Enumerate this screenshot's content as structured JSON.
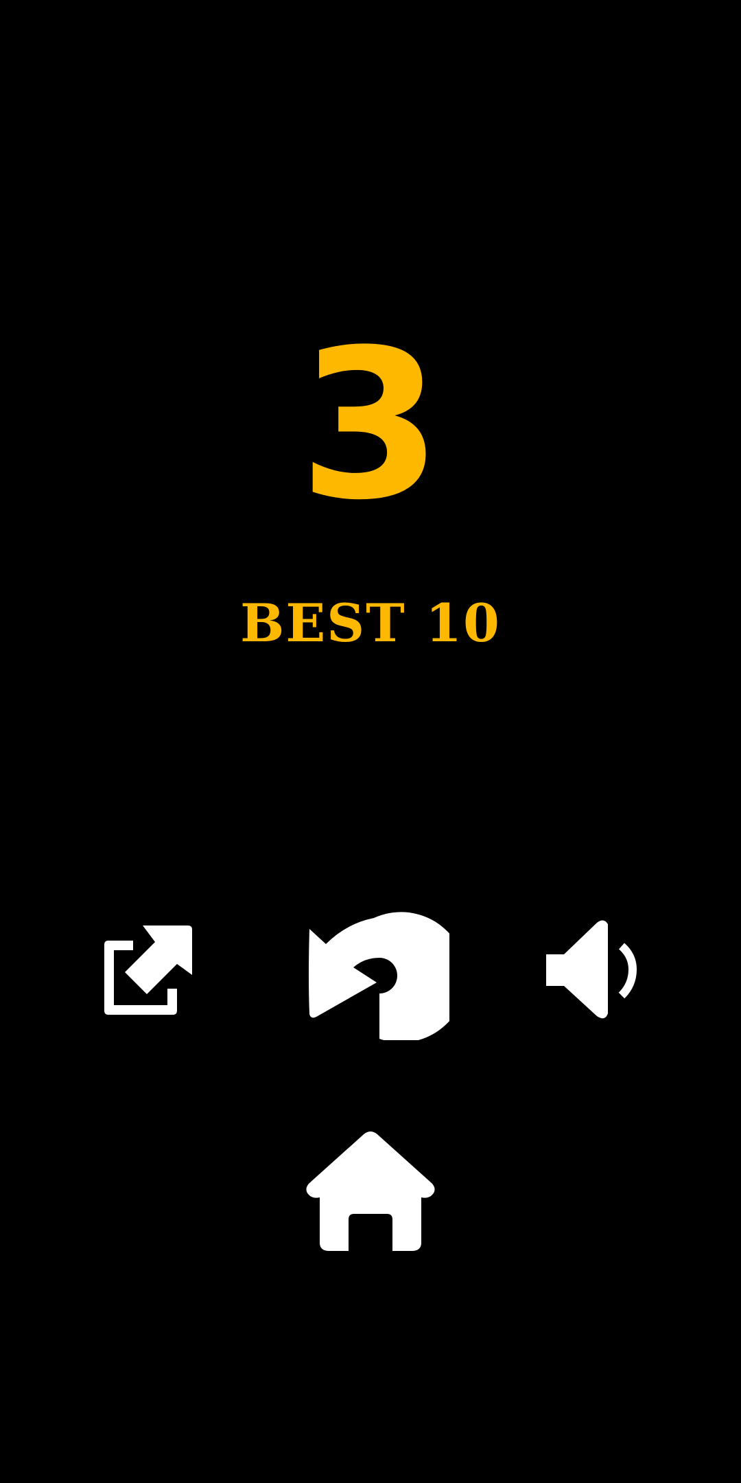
{
  "game": {
    "score": "3",
    "best_label": "BEST",
    "best_value": "10"
  },
  "colors": {
    "background": "#000000",
    "accent": "#FFB800",
    "icon": "#FFFFFF"
  },
  "icons": {
    "share": "share-external-icon",
    "restart": "restart-icon",
    "sound": "speaker-icon",
    "home": "home-icon"
  }
}
